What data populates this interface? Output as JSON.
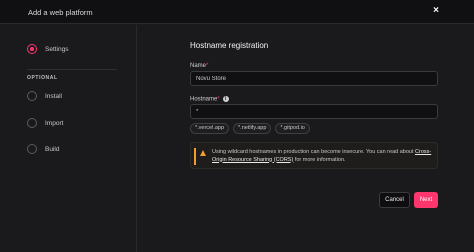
{
  "header": {
    "title": "Add a web platform",
    "close_symbol": "×"
  },
  "sidebar": {
    "steps": [
      {
        "label": "Settings",
        "active": true
      },
      {
        "label": "Install",
        "active": false
      },
      {
        "label": "Import",
        "active": false
      },
      {
        "label": "Build",
        "active": false
      }
    ],
    "optional_label": "OPTIONAL"
  },
  "main": {
    "section_title": "Hostname registration",
    "name_field": {
      "label": "Name",
      "required_mark": "*",
      "value": "Novu Store"
    },
    "hostname_field": {
      "label": "Hostname",
      "required_mark": "*",
      "value": "*"
    },
    "suggestions": [
      "*.vercel.app",
      "*.netlify.app",
      "*.gitpod.io"
    ],
    "alert": {
      "text": "Using wildcard hostnames in production can become insecure. You can read about ",
      "link": "Cross-Origin Resource Sharing (CORS)",
      "text_after": " for more information."
    }
  },
  "footer": {
    "cancel_label": "Cancel",
    "next_label": "Next"
  },
  "colors": {
    "accent": "#fd366e",
    "warning": "#f39c32"
  }
}
